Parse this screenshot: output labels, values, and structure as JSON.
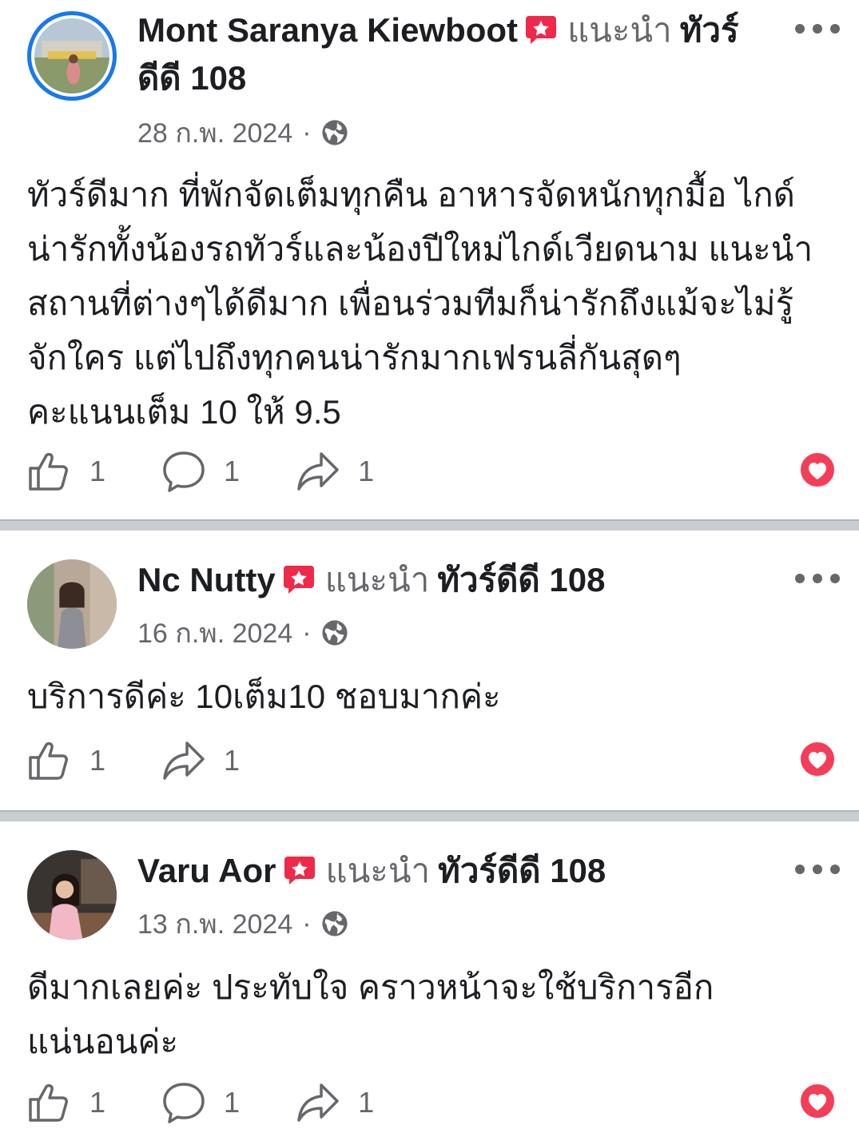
{
  "posts": [
    {
      "author": "Mont Saranya Kiewboot",
      "recommends": "แนะนำ",
      "page": "ทัวร์ดีดี 108",
      "date": "28 ก.พ. 2024",
      "dot": "·",
      "text": "ทัวร์ดีมาก ที่พักจัดเต็มทุกคืน อาหารจัดหนักทุกมื้อ ไกด์น่ารักทั้งน้องรถทัวร์และน้องปีใหม่ไกด์เวียดนาม แนะนำสถานที่ต่างๆได้ดีมาก  เพื่อนร่วมทีมก็น่ารักถึงแม้จะไม่รู้จักใคร แต่ไปถึงทุกคนน่ารักมากเฟรนลี่กันสุดๆ\nคะแนนเต็ม 10 ให้ 9.5",
      "likes": "1",
      "comments": "1",
      "shares": "1"
    },
    {
      "author": "Nc Nutty",
      "recommends": "แนะนำ",
      "page": "ทัวร์ดีดี 108",
      "date": "16 ก.พ. 2024",
      "dot": "·",
      "text": "บริการดีค่ะ 10เต็ม10 ชอบมากค่ะ",
      "likes": "1",
      "shares": "1"
    },
    {
      "author": "Varu Aor",
      "recommends": "แนะนำ",
      "page": "ทัวร์ดีดี 108",
      "date": "13 ก.พ. 2024",
      "dot": "·",
      "text": "ดีมากเลยค่ะ ประทับใจ คราวหน้าจะใช้บริการอีกแน่นอนค่ะ",
      "likes": "1",
      "comments": "1",
      "shares": "1"
    }
  ],
  "colors": {
    "text": "#1c1e21",
    "secondary": "#65676b",
    "badge": "#f02849",
    "heart": "#f33e58",
    "avatar_ring": "#1877f2"
  },
  "icons": [
    "recommend-badge-icon",
    "globe-icon",
    "more-icon",
    "like-icon",
    "comment-icon",
    "share-icon",
    "love-reaction-icon"
  ]
}
